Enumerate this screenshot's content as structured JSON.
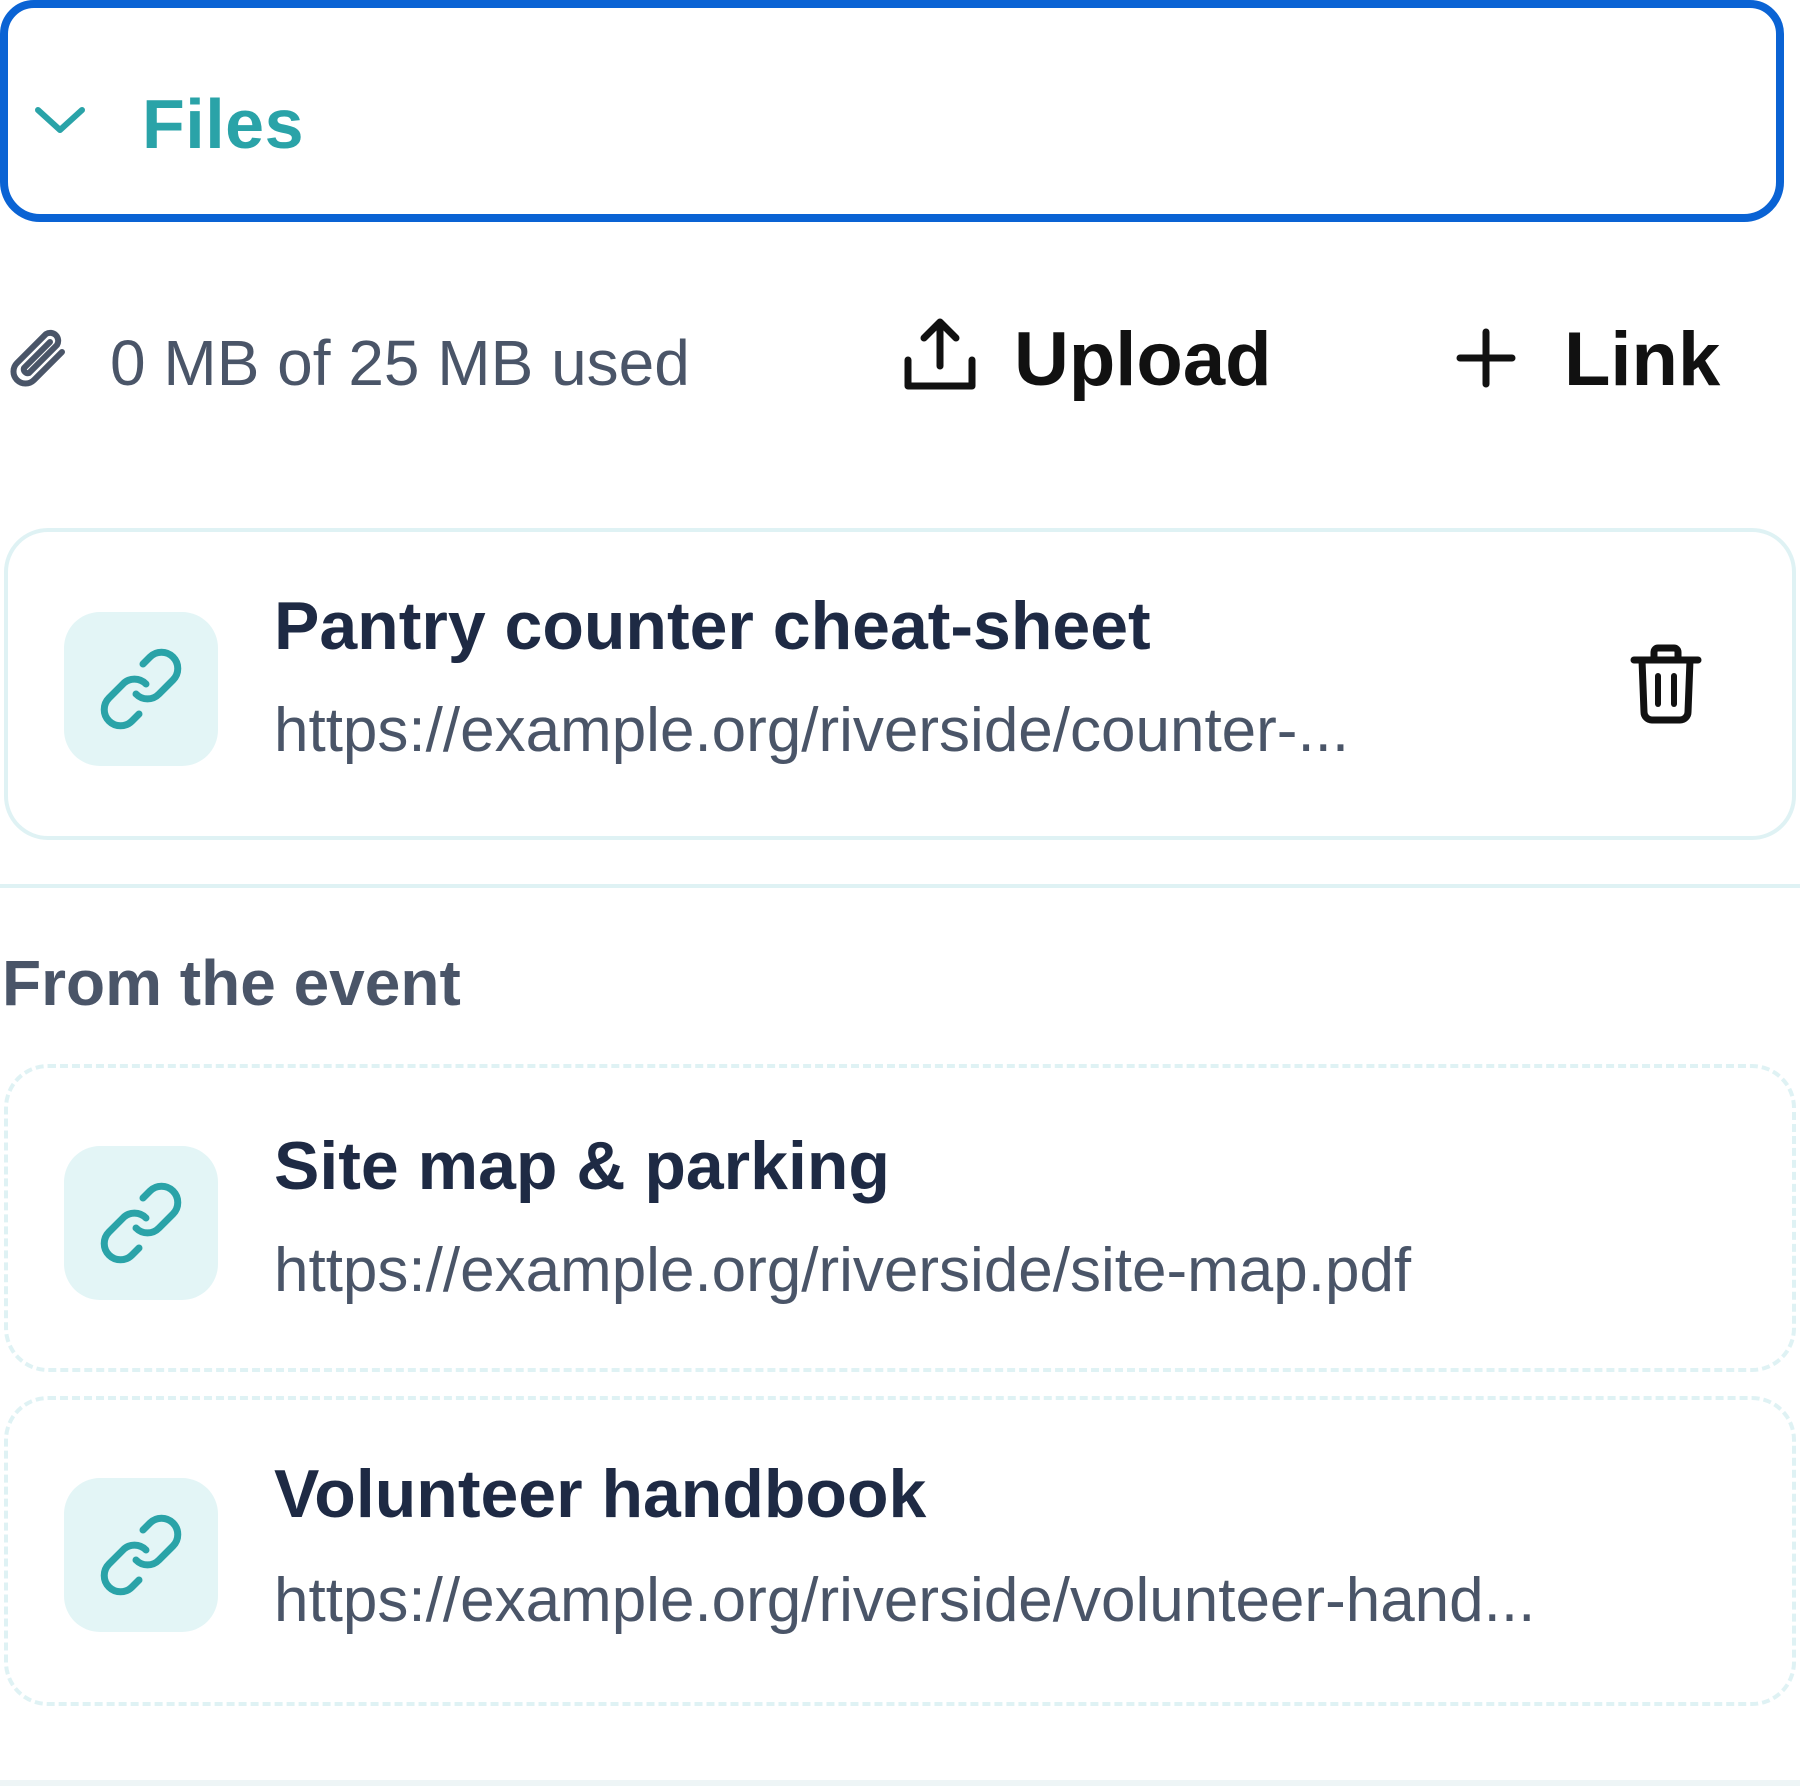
{
  "files_section": {
    "title": "Files",
    "expanded": true,
    "accent_color": "#2aa3a8",
    "focus_ring_color": "#0a63d4"
  },
  "toolbar": {
    "usage_text": "0 MB of 25 MB used",
    "upload_label": "Upload",
    "link_label": "Link",
    "clip_icon": "paperclip-icon",
    "upload_icon": "upload-icon",
    "link_add_icon": "plus-icon"
  },
  "attachments": [
    {
      "title": "Pantry counter cheat-sheet",
      "url": "https://example.org/riverside/counter-...",
      "icon": "link-icon",
      "deletable": true
    }
  ],
  "event_section": {
    "label": "From the event",
    "items": [
      {
        "title": "Site map & parking",
        "url": "https://example.org/riverside/site-map.pdf",
        "icon": "link-icon"
      },
      {
        "title": "Volunteer handbook",
        "url": "https://example.org/riverside/volunteer-hand...",
        "icon": "link-icon"
      }
    ]
  }
}
